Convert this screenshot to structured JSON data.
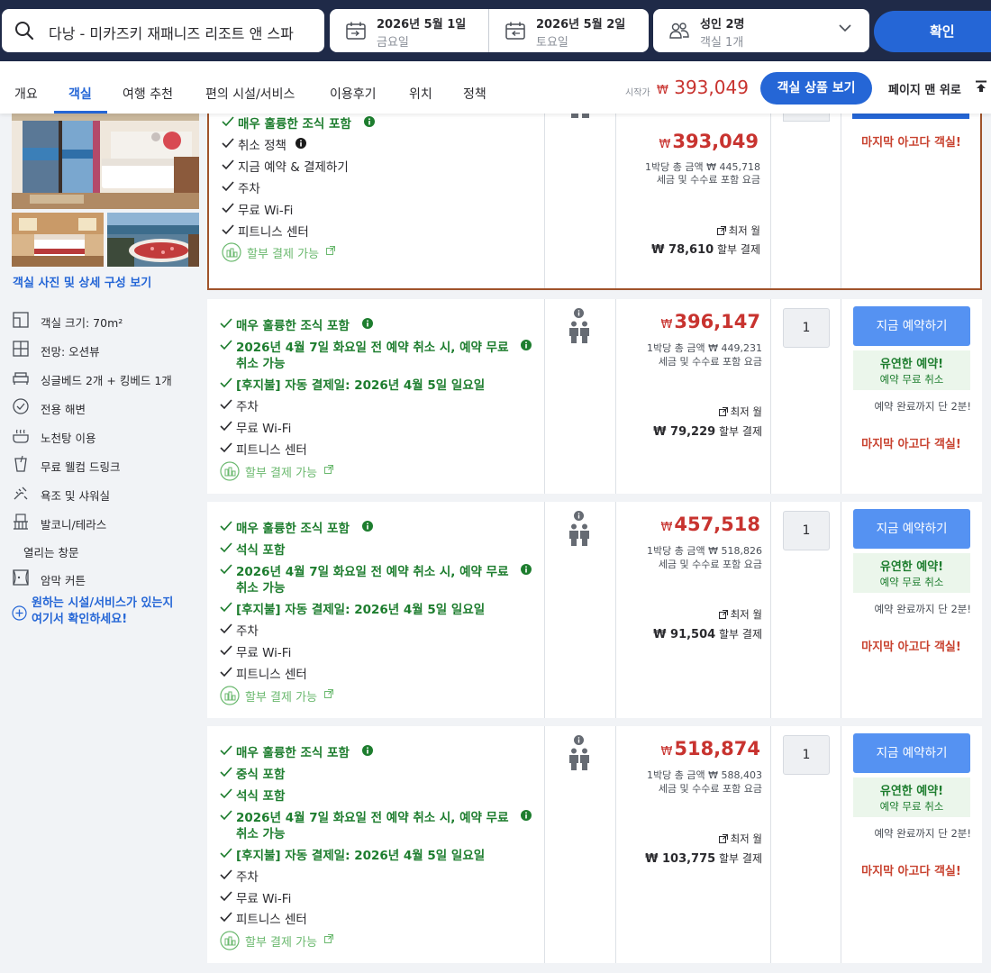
{
  "search": {
    "destination": "다낭 - 미카즈키 재패니즈 리조트 앤 스파",
    "checkin_date": "2026년 5월 1일",
    "checkin_day": "금요일",
    "checkout_date": "2026년 5월 2일",
    "checkout_day": "토요일",
    "guests": "성인 2명",
    "rooms": "객실 1개",
    "confirm_label": "확인"
  },
  "tabs": [
    "개요",
    "객실",
    "여행 추천",
    "편의 시설/서비스",
    "이용후기",
    "위치",
    "정책"
  ],
  "active_tab": "객실",
  "header_price": {
    "start_label": "시작가",
    "currency": "₩",
    "amount": "393,049",
    "deals_button": "객실 상품 보기",
    "to_top": "페이지 맨 위로"
  },
  "room": {
    "photos_link": "객실 사진 및 상세 구성 보기",
    "features": [
      {
        "icon": "room-size-icon",
        "text": "객실 크기: 70m²"
      },
      {
        "icon": "view-icon",
        "text": "전망: 오션뷰"
      },
      {
        "icon": "bed-icon",
        "text": "싱글베드 2개 + 킹베드 1개"
      },
      {
        "icon": "beach-icon",
        "text": "전용 해변"
      },
      {
        "icon": "onsen-icon",
        "text": "노천탕 이용"
      },
      {
        "icon": "drink-icon",
        "text": "무료 웰컴 드링크"
      },
      {
        "icon": "shower-icon",
        "text": "욕조 및 샤워실"
      },
      {
        "icon": "balcony-icon",
        "text": "발코니/테라스"
      },
      {
        "icon": "",
        "text": "열리는 창문"
      },
      {
        "icon": "curtain-icon",
        "text": "암막 커튼"
      }
    ],
    "facility_link_line1": "원하는 시설/서비스가 있는지",
    "facility_link_line2": "여기서 확인하세요!"
  },
  "offers": [
    {
      "benefits": [
        {
          "text": "매우 훌륭한 조식 포함",
          "green": true,
          "info": true
        },
        {
          "text": "취소 정책",
          "green": false,
          "info": true,
          "dark_info": true
        },
        {
          "text": "지금 예약 & 결제하기",
          "green": false
        },
        {
          "text": "주차",
          "green": false
        },
        {
          "text": "무료 Wi-Fi",
          "green": false
        },
        {
          "text": "피트니스 센터",
          "green": false
        }
      ],
      "installment": "할부 결제 가능",
      "currency": "₩",
      "price": "393,049",
      "total": "1박당 총 금액 ₩ 445,718",
      "tax": "세금 및 수수료 포함 요금",
      "min_monthly_label": "최저 월",
      "monthly": "₩ 78,610",
      "monthly_suffix": "할부 결제",
      "last_room": "마지막 아고다 객실!"
    },
    {
      "benefits": [
        {
          "text": "매우 훌륭한 조식 포함",
          "green": true,
          "info": true
        },
        {
          "text": "2026년 4월 7일 화요일 전 예약 취소 시, 예약 무료",
          "text2": "취소 가능",
          "green": true,
          "info": true
        },
        {
          "text": "[후지불] 자동 결제일: 2026년 4월 5일 일요일",
          "green": true
        },
        {
          "text": "주차",
          "green": false
        },
        {
          "text": "무료 Wi-Fi",
          "green": false
        },
        {
          "text": "피트니스 센터",
          "green": false
        }
      ],
      "installment": "할부 결제 가능",
      "currency": "₩",
      "price": "396,147",
      "total": "1박당 총 금액 ₩ 449,231",
      "tax": "세금 및 수수료 포함 요금",
      "min_monthly_label": "최저 월",
      "monthly": "₩ 79,229",
      "monthly_suffix": "할부 결제",
      "quantity": "1",
      "book_label": "지금 예약하기",
      "flex_title": "유연한 예약!",
      "flex_sub": "예약 무료 취소",
      "booking_time": "예약 완료까지 단 2분!",
      "last_room": "마지막 아고다 객실!"
    },
    {
      "benefits": [
        {
          "text": "매우 훌륭한 조식 포함",
          "green": true,
          "info": true
        },
        {
          "text": "석식 포함",
          "green": true
        },
        {
          "text": "2026년 4월 7일 화요일 전 예약 취소 시, 예약 무료",
          "text2": "취소 가능",
          "green": true,
          "info": true
        },
        {
          "text": "[후지불] 자동 결제일: 2026년 4월 5일 일요일",
          "green": true
        },
        {
          "text": "주차",
          "green": false
        },
        {
          "text": "무료 Wi-Fi",
          "green": false
        },
        {
          "text": "피트니스 센터",
          "green": false
        }
      ],
      "installment": "할부 결제 가능",
      "currency": "₩",
      "price": "457,518",
      "total": "1박당 총 금액 ₩ 518,826",
      "tax": "세금 및 수수료 포함 요금",
      "min_monthly_label": "최저 월",
      "monthly": "₩ 91,504",
      "monthly_suffix": "할부 결제",
      "quantity": "1",
      "book_label": "지금 예약하기",
      "flex_title": "유연한 예약!",
      "flex_sub": "예약 무료 취소",
      "booking_time": "예약 완료까지 단 2분!",
      "last_room": "마지막 아고다 객실!"
    },
    {
      "benefits": [
        {
          "text": "매우 훌륭한 조식 포함",
          "green": true,
          "info": true
        },
        {
          "text": "중식 포함",
          "green": true
        },
        {
          "text": "석식 포함",
          "green": true
        },
        {
          "text": "2026년 4월 7일 화요일 전 예약 취소 시, 예약 무료",
          "text2": "취소 가능",
          "green": true,
          "info": true
        },
        {
          "text": "[후지불] 자동 결제일: 2026년 4월 5일 일요일",
          "green": true
        },
        {
          "text": "주차",
          "green": false
        },
        {
          "text": "무료 Wi-Fi",
          "green": false
        },
        {
          "text": "피트니스 센터",
          "green": false
        }
      ],
      "installment": "할부 결제 가능",
      "currency": "₩",
      "price": "518,874",
      "total": "1박당 총 금액 ₩ 588,403",
      "tax": "세금 및 수수료 포함 요금",
      "min_monthly_label": "최저 월",
      "monthly": "₩ 103,775",
      "monthly_suffix": "할부 결제",
      "quantity": "1",
      "book_label": "지금 예약하기",
      "flex_title": "유연한 예약!",
      "flex_sub": "예약 무료 취소",
      "booking_time": "예약 완료까지 단 2분!",
      "last_room": "마지막 아고다 객실!"
    }
  ],
  "colors": {
    "brand_blue": "#2566d6",
    "header_bg": "#1f2a48",
    "price_red": "#c8332f",
    "benefit_green": "#1d7d2e",
    "highlight_border": "#a0532b"
  }
}
